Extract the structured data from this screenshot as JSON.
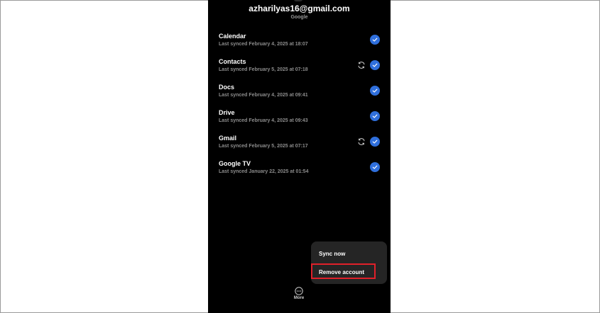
{
  "account": {
    "email": "azharilyas16@gmail.com",
    "provider": "Google"
  },
  "sync_items": [
    {
      "name": "Calendar",
      "last_synced": "Last synced February 4, 2025 at 18:07",
      "syncing": false,
      "enabled": true
    },
    {
      "name": "Contacts",
      "last_synced": "Last synced February 5, 2025 at 07:18",
      "syncing": true,
      "enabled": true
    },
    {
      "name": "Docs",
      "last_synced": "Last synced February 4, 2025 at 09:41",
      "syncing": false,
      "enabled": true
    },
    {
      "name": "Drive",
      "last_synced": "Last synced February 4, 2025 at 09:43",
      "syncing": false,
      "enabled": true
    },
    {
      "name": "Gmail",
      "last_synced": "Last synced February 5, 2025 at 07:17",
      "syncing": true,
      "enabled": true
    },
    {
      "name": "Google TV",
      "last_synced": "Last synced January 22, 2025 at 01:54",
      "syncing": false,
      "enabled": true
    }
  ],
  "menu": {
    "sync_now": "Sync now",
    "remove_account": "Remove account"
  },
  "bottom_bar": {
    "more_label": "More",
    "more_icon": "more-horizontal-icon"
  },
  "colors": {
    "check_fill": "#2f6fdc",
    "highlight": "#e0202a",
    "menu_bg": "#252525",
    "screen_bg": "#000000"
  }
}
